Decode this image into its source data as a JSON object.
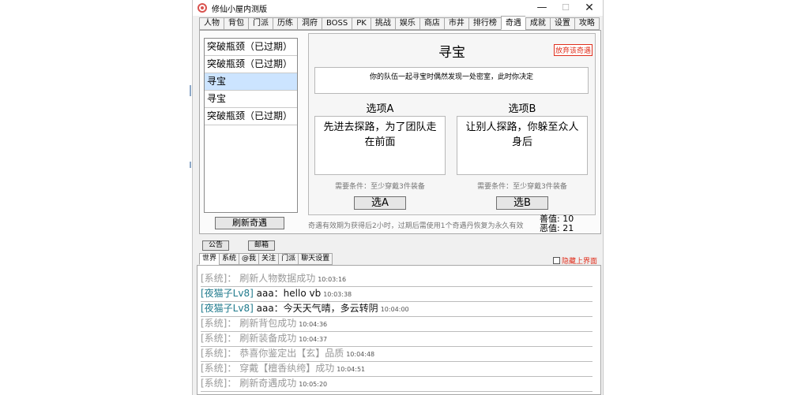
{
  "window": {
    "title": "修仙小屋内测版"
  },
  "tabs": [
    {
      "label": "人物",
      "active": false
    },
    {
      "label": "背包",
      "active": false
    },
    {
      "label": "门派",
      "active": false
    },
    {
      "label": "历练",
      "active": false
    },
    {
      "label": "洞府",
      "active": false
    },
    {
      "label": "BOSS",
      "active": false
    },
    {
      "label": "PK",
      "active": false
    },
    {
      "label": "挑战",
      "active": false
    },
    {
      "label": "娱乐",
      "active": false
    },
    {
      "label": "商店",
      "active": false
    },
    {
      "label": "市井",
      "active": false
    },
    {
      "label": "排行榜",
      "active": false
    },
    {
      "label": "奇遇",
      "active": true
    },
    {
      "label": "成就",
      "active": false
    },
    {
      "label": "设置",
      "active": false
    },
    {
      "label": "攻略",
      "active": false
    }
  ],
  "events": {
    "items": [
      {
        "label": "突破瓶颈（已过期）",
        "selected": false
      },
      {
        "label": "突破瓶颈（已过期）",
        "selected": false
      },
      {
        "label": "寻宝",
        "selected": true
      },
      {
        "label": "寻宝",
        "selected": false
      },
      {
        "label": "突破瓶颈（已过期）",
        "selected": false
      }
    ],
    "refresh_label": "刷新奇遇"
  },
  "detail": {
    "title": "寻宝",
    "abandon_label": "放弃该奇遇",
    "description": "你的队伍一起寻宝时偶然发现一处密室，此时你决定",
    "option_a": {
      "label": "选项A",
      "text": "先进去探路，为了团队走在前面",
      "condition": "需要条件：至少穿戴3件装备",
      "button": "选A"
    },
    "option_b": {
      "label": "选项B",
      "text": "让别人探路，你躲至众人身后",
      "condition": "需要条件：至少穿戴3件装备",
      "button": "选B"
    }
  },
  "validity_note": "奇遇有效期为获得后2小时，过期后需使用1个奇遇丹恢复为永久有效",
  "stats": {
    "good_label": "善值:",
    "good_value": "10",
    "evil_label": "恶值:",
    "evil_value": "21"
  },
  "bottom_buttons": {
    "announce": "公告",
    "mail": "邮箱"
  },
  "chat": {
    "tabs": [
      {
        "label": "世界",
        "active": true
      },
      {
        "label": "系统",
        "active": false
      },
      {
        "label": "@我",
        "active": false
      },
      {
        "label": "关注",
        "active": false
      },
      {
        "label": "门派",
        "active": false
      },
      {
        "label": "聊天设置",
        "active": false
      }
    ],
    "hide_label": "隐藏上界面",
    "messages": [
      {
        "tag": "[系统]：",
        "text": "刷新人物数据成功",
        "time": "10:03:16",
        "kind": "sys"
      },
      {
        "tag": "[夜猫子Lv8]",
        "text": "aaa：hello vb",
        "time": "10:03:38",
        "kind": "player"
      },
      {
        "tag": "[夜猫子Lv8]",
        "text": "aaa：今天天气晴，多云转阴",
        "time": "10:04:00",
        "kind": "player"
      },
      {
        "tag": "[系统]：",
        "text": "刷新背包成功",
        "time": "10:04:36",
        "kind": "sys"
      },
      {
        "tag": "[系统]：",
        "text": "刷新装备成功",
        "time": "10:04:37",
        "kind": "sys"
      },
      {
        "tag": "[系统]：",
        "text": "恭喜你鉴定出【玄】品质",
        "time": "10:04:48",
        "kind": "sys"
      },
      {
        "tag": "[系统]：",
        "text": "穿戴【檀香纨绔】成功",
        "time": "10:04:51",
        "kind": "sys"
      },
      {
        "tag": "[系统]：",
        "text": "刷新奇遇成功",
        "time": "10:05:20",
        "kind": "sys"
      }
    ]
  },
  "colors": {
    "accent_red": "#e0301e",
    "selection": "#cce4ff",
    "player_tag": "#1f7a8c",
    "system_text": "#999999"
  }
}
